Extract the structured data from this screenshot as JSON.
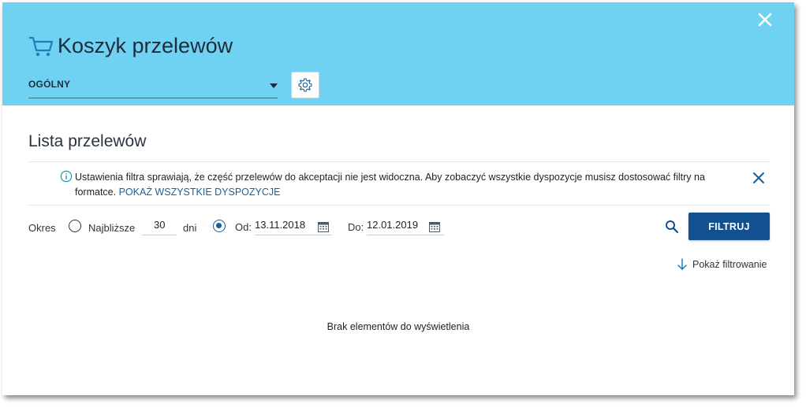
{
  "header": {
    "title": "Koszyk przelewów",
    "select_value": "OGÓLNY"
  },
  "list": {
    "title": "Lista przelewów"
  },
  "notice": {
    "text": "Ustawienia filtra sprawiają, że część przelewów do akceptacji nie jest widoczna. Aby zobaczyć wszystkie dyspozycje musisz dostosować filtry na formatce.",
    "link": "POKAŻ WSZYSTKIE DYSPOZYCJE"
  },
  "filters": {
    "period_label": "Okres",
    "nearest_label": "Najbliższe",
    "nearest_days": "30",
    "days_label": "dni",
    "from_label": "Od:",
    "from_value": "13.11.2018",
    "to_label": "Do:",
    "to_value": "12.01.2019",
    "filter_button": "FILTRUJ",
    "show_filtering": "Pokaż filtrowanie"
  },
  "empty_message": "Brak elementów do wyświetlenia",
  "colors": {
    "header_bg": "#6fd2f2",
    "primary": "#12508f",
    "link": "#1b5f97"
  },
  "icons": [
    "cart-icon",
    "close-icon",
    "chevron-down-icon",
    "gear-icon",
    "info-icon",
    "calendar-icon",
    "search-icon",
    "arrow-down-icon"
  ]
}
